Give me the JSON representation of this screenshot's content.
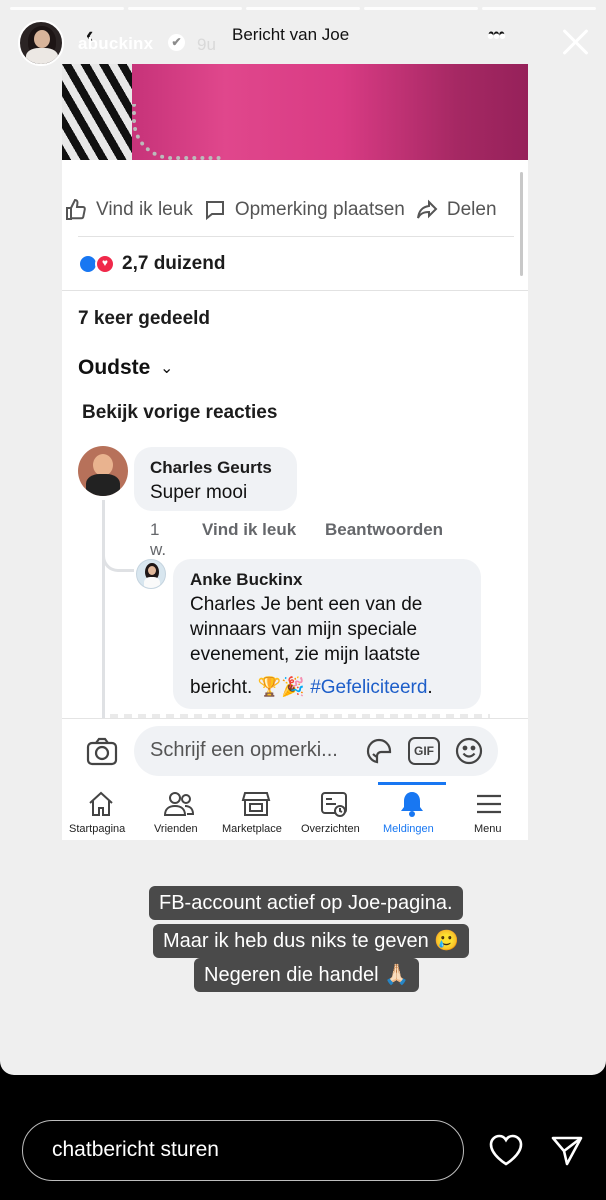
{
  "story": {
    "username": "abuckinx",
    "verified_glyph": "✔",
    "time": "9u",
    "progress_segments": 5,
    "more_glyph": "•••",
    "captions": [
      "FB-account actief op Joe-pagina.",
      "Maar ik heb dus niks te geven 🥲",
      "Negeren die handel 🙏🏻"
    ],
    "reply_placeholder": "chatbericht sturen"
  },
  "fb": {
    "header": {
      "back_glyph": "‹",
      "title": "Bericht van Joe",
      "more_glyph": "•••"
    },
    "actions": {
      "like": "Vind ik leuk",
      "comment": "Opmerking plaatsen",
      "share": "Delen"
    },
    "reactions": {
      "count": "2,7 duizend"
    },
    "shares": "7 keer gedeeld",
    "sort_label": "Oudste",
    "sort_caret": "⌄",
    "previous_comments": "Bekijk vorige reacties",
    "comments": [
      {
        "name": "Charles Geurts",
        "text": "Super mooi",
        "time": "1 w.",
        "like": "Vind ik leuk",
        "reply": "Beantwoorden"
      },
      {
        "name": "Anke Buckinx",
        "lines": [
          "Charles Je bent een van de",
          "winnaars van mijn speciale",
          "evenement, zie mijn laatste"
        ],
        "last_line_prefix": "bericht. 🏆🎉 ",
        "hashtag": "#Gefeliciteerd",
        "last_line_suffix": "."
      }
    ],
    "composer_placeholder": "Schrijf een opmerki...",
    "gif_label": "GIF",
    "tabs": [
      {
        "label": "Startpagina",
        "icon": "home-icon",
        "active": false
      },
      {
        "label": "Vrienden",
        "icon": "friends-icon",
        "active": false
      },
      {
        "label": "Marketplace",
        "icon": "marketplace-icon",
        "active": false
      },
      {
        "label": "Overzichten",
        "icon": "feeds-icon",
        "active": false
      },
      {
        "label": "Meldingen",
        "icon": "bell-icon",
        "active": true
      },
      {
        "label": "Menu",
        "icon": "menu-icon",
        "active": false
      }
    ]
  },
  "colors": {
    "fb_blue": "#1877f2",
    "caption_bg": "#4a4a4a",
    "story_bg": "#efefef"
  }
}
